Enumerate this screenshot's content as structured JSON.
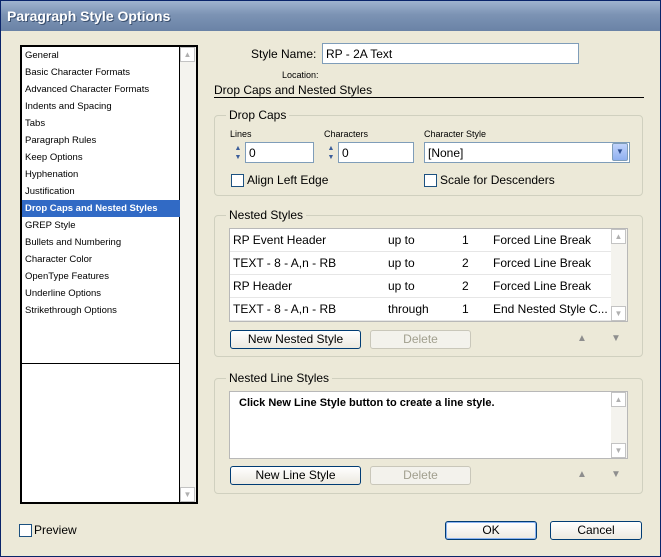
{
  "window": {
    "title": "Paragraph Style Options"
  },
  "categories": [
    "General",
    "Basic Character Formats",
    "Advanced Character Formats",
    "Indents and Spacing",
    "Tabs",
    "Paragraph Rules",
    "Keep Options",
    "Hyphenation",
    "Justification",
    "Drop Caps and Nested Styles",
    "GREP Style",
    "Bullets and Numbering",
    "Character Color",
    "OpenType Features",
    "Underline Options",
    "Strikethrough Options"
  ],
  "selected_category": "Drop Caps and Nested Styles",
  "style_name": {
    "label": "Style Name:",
    "value": "RP - 2A Text"
  },
  "location_label": "Location:",
  "section_title": "Drop Caps and Nested Styles",
  "drop_caps": {
    "title": "Drop Caps",
    "lines_label": "Lines",
    "lines_value": "0",
    "characters_label": "Characters",
    "characters_value": "0",
    "char_style_label": "Character Style",
    "char_style_value": "[None]",
    "align_left_edge": "Align Left Edge",
    "scale_for_descenders": "Scale for Descenders"
  },
  "nested_styles": {
    "title": "Nested Styles",
    "rows": [
      {
        "style": "RP Event Header",
        "op": "up to",
        "count": "1",
        "until": "Forced Line Break"
      },
      {
        "style": "TEXT - 8 - A,n - RB",
        "op": "up to",
        "count": "2",
        "until": "Forced Line Break"
      },
      {
        "style": "RP Header",
        "op": "up to",
        "count": "2",
        "until": "Forced Line Break"
      },
      {
        "style": "TEXT - 8 - A,n - RB",
        "op": "through",
        "count": "1",
        "until": "End Nested Style C..."
      }
    ],
    "new_button": "New Nested Style",
    "delete_button": "Delete"
  },
  "nested_line_styles": {
    "title": "Nested Line Styles",
    "hint": "Click New Line Style button to create a line style.",
    "new_button": "New Line Style",
    "delete_button": "Delete"
  },
  "preview_label": "Preview",
  "ok_button": "OK",
  "cancel_button": "Cancel",
  "colors": {
    "selection": "#316ac5",
    "dialog_bg": "#ece9d8",
    "title_bar": "#7c93b4"
  }
}
